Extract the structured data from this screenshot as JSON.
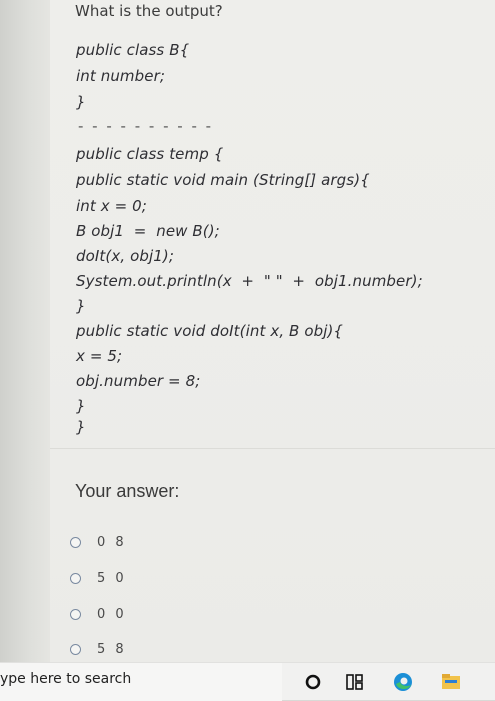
{
  "question": {
    "title": "What is the output?"
  },
  "code": {
    "lines": [
      "public class B{",
      "int number;",
      "}",
      "public class temp {",
      "public static void main (String[] args){",
      "int x = 0;",
      "B obj1  =  new B();",
      "doIt(x, obj1);",
      "System.out.println(x  +  \" \"  +  obj1.number);",
      "}",
      "public static void doIt(int x, B obj){",
      "x = 5;",
      "obj.number = 8;",
      "}",
      "}"
    ],
    "separator": "- - - - - - - - - -"
  },
  "answer": {
    "heading": "Your answer:",
    "options": [
      "0 8",
      "5 0",
      "0 0",
      "5 8"
    ]
  },
  "taskbar": {
    "search_text": "ype here to search"
  },
  "colors": {
    "radio_border": "#7a8aa0",
    "edge_icon_blue": "#1b8fd6",
    "edge_icon_green": "#41c06a",
    "file_explorer_yellow": "#f2c34b"
  }
}
